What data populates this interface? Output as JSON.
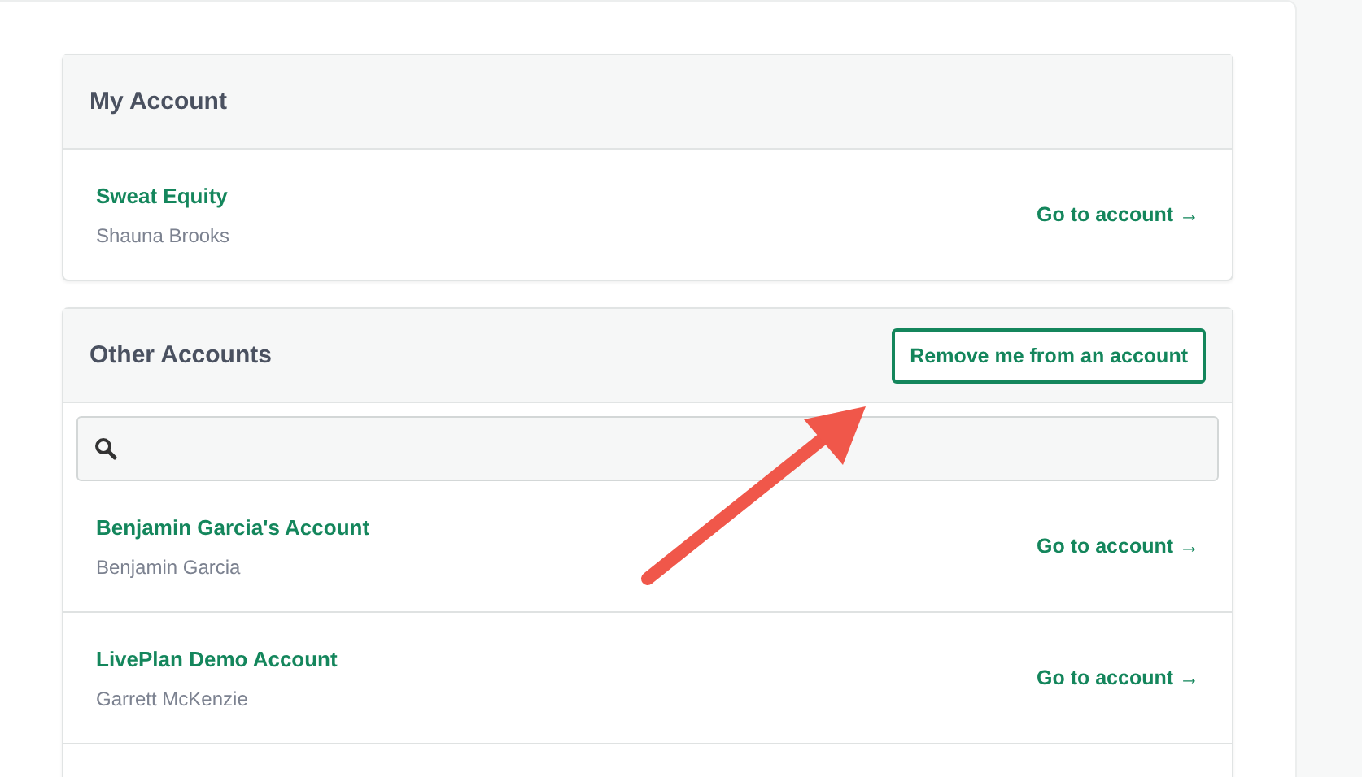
{
  "my_account": {
    "title": "My Account",
    "accounts": [
      {
        "name": "Sweat Equity",
        "owner": "Shauna Brooks",
        "link": "Go to account →"
      }
    ]
  },
  "other_accounts": {
    "title": "Other Accounts",
    "button": "Remove me from an account",
    "accounts": [
      {
        "name": "Benjamin Garcia's Account",
        "owner": "Benjamin Garcia",
        "link": "Go to account →"
      },
      {
        "name": "LivePlan Demo Account",
        "owner": "Garrett McKenzie",
        "link": "Go to account →"
      }
    ]
  }
}
